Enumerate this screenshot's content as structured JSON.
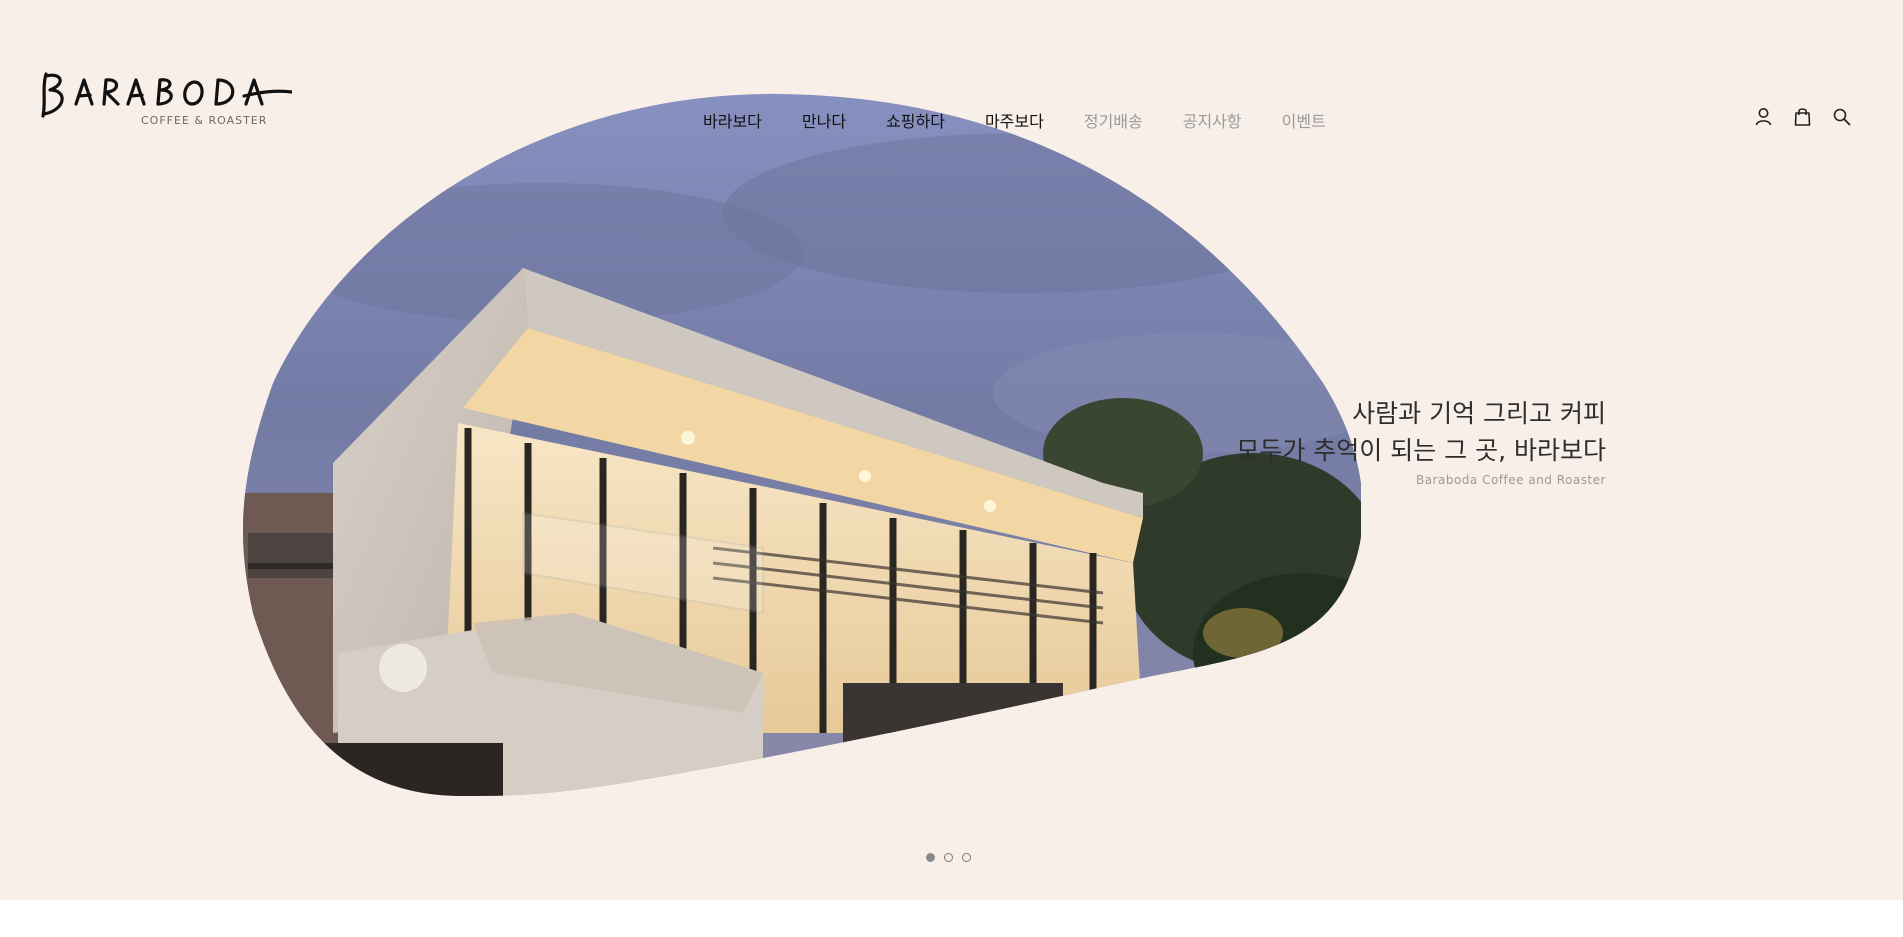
{
  "brand": {
    "logo_text": "BARABODA",
    "logo_subtitle": "COFFEE & ROASTER"
  },
  "nav": {
    "items": [
      {
        "label": "바라보다",
        "state": "active"
      },
      {
        "label": "만나다",
        "state": "active"
      },
      {
        "label": "쇼핑하다",
        "state": "active"
      },
      {
        "label": "마주보다",
        "state": "active"
      },
      {
        "label": "정기배송",
        "state": "muted"
      },
      {
        "label": "공지사항",
        "state": "muted"
      },
      {
        "label": "이벤트",
        "state": "muted"
      }
    ]
  },
  "header_icons": [
    {
      "name": "user-icon"
    },
    {
      "name": "shopping-bag-icon"
    },
    {
      "name": "search-icon"
    }
  ],
  "hero": {
    "line1": "사람과 기억 그리고 커피",
    "line2": "모두가 추억이 되는 그 곳, 바라보다",
    "subtitle": "Baraboda Coffee and Roaster",
    "image_subject": "building-exterior-photo"
  },
  "carousel": {
    "total": 3,
    "active_index": 0
  },
  "colors": {
    "hero_bg": "#f8efe9",
    "text_dark": "#111111",
    "text_muted": "#9a9a9a",
    "sky": "#7b83ad"
  }
}
